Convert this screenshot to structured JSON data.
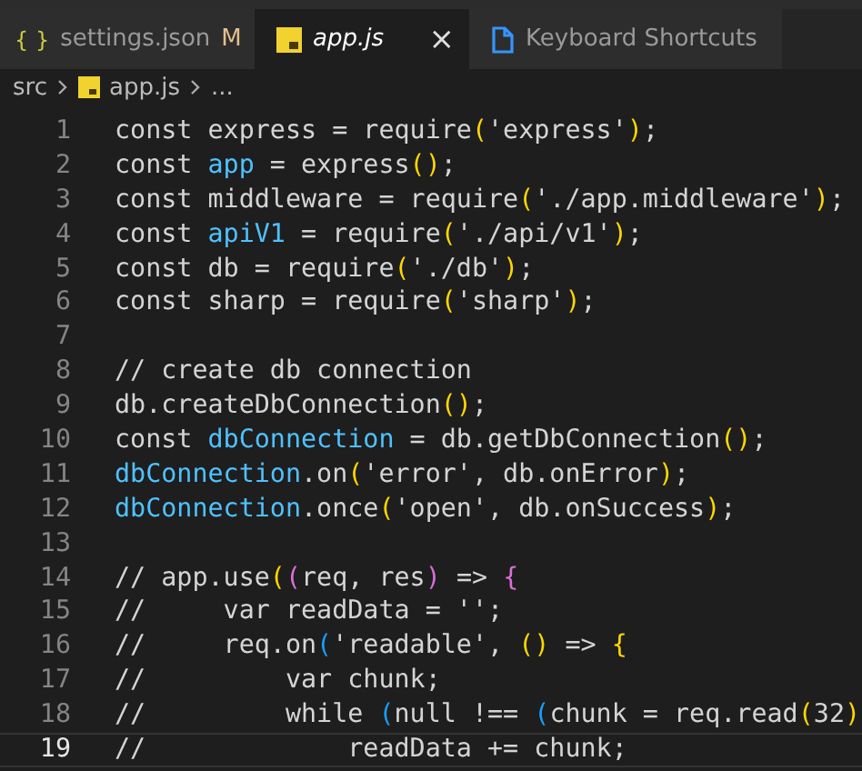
{
  "tabs": [
    {
      "kind": "json",
      "label": "settings.json",
      "badge": "M",
      "selected": false,
      "icon_text": "{ }"
    },
    {
      "kind": "js",
      "label": "app.js",
      "selected": true,
      "close": "×"
    },
    {
      "kind": "doc",
      "label": "Keyboard Shortcuts",
      "selected": false
    }
  ],
  "breadcrumb": {
    "folder": "src",
    "file": "app.js",
    "more": "..."
  },
  "lines": [
    {
      "number": "1",
      "current": false,
      "tokens": [
        {
          "kind": "text",
          "text": "const express = require"
        },
        {
          "kind": "bracket1",
          "text": "("
        },
        {
          "kind": "text",
          "text": "'express'"
        },
        {
          "kind": "bracket1",
          "text": ")"
        },
        {
          "kind": "text",
          "text": ";"
        }
      ]
    },
    {
      "number": "2",
      "current": false,
      "tokens": [
        {
          "kind": "text",
          "text": "const "
        },
        {
          "kind": "variable",
          "text": "app"
        },
        {
          "kind": "text",
          "text": " = express"
        },
        {
          "kind": "bracket1",
          "text": "()"
        },
        {
          "kind": "text",
          "text": ";"
        }
      ]
    },
    {
      "number": "3",
      "current": false,
      "tokens": [
        {
          "kind": "text",
          "text": "const middleware = require"
        },
        {
          "kind": "bracket1",
          "text": "("
        },
        {
          "kind": "text",
          "text": "'./app.middleware'"
        },
        {
          "kind": "bracket1",
          "text": ")"
        },
        {
          "kind": "text",
          "text": ";"
        }
      ]
    },
    {
      "number": "4",
      "current": false,
      "tokens": [
        {
          "kind": "text",
          "text": "const "
        },
        {
          "kind": "variable",
          "text": "apiV1"
        },
        {
          "kind": "text",
          "text": " = require"
        },
        {
          "kind": "bracket1",
          "text": "("
        },
        {
          "kind": "text",
          "text": "'./api/v1'"
        },
        {
          "kind": "bracket1",
          "text": ")"
        },
        {
          "kind": "text",
          "text": ";"
        }
      ]
    },
    {
      "number": "5",
      "current": false,
      "tokens": [
        {
          "kind": "text",
          "text": "const db = require"
        },
        {
          "kind": "bracket1",
          "text": "("
        },
        {
          "kind": "text",
          "text": "'./db'"
        },
        {
          "kind": "bracket1",
          "text": ")"
        },
        {
          "kind": "text",
          "text": ";"
        }
      ]
    },
    {
      "number": "6",
      "current": false,
      "tokens": [
        {
          "kind": "text",
          "text": "const sharp = require"
        },
        {
          "kind": "bracket1",
          "text": "("
        },
        {
          "kind": "text",
          "text": "'sharp'"
        },
        {
          "kind": "bracket1",
          "text": ")"
        },
        {
          "kind": "text",
          "text": ";"
        }
      ]
    },
    {
      "number": "7",
      "current": false
    },
    {
      "number": "8",
      "current": false,
      "tokens": [
        {
          "kind": "text",
          "text": "// create db connection"
        }
      ]
    },
    {
      "number": "9",
      "current": false,
      "tokens": [
        {
          "kind": "text",
          "text": "db.createDbConnection"
        },
        {
          "kind": "bracket1",
          "text": "()"
        },
        {
          "kind": "text",
          "text": ";"
        }
      ]
    },
    {
      "number": "10",
      "current": false,
      "tokens": [
        {
          "kind": "text",
          "text": "const "
        },
        {
          "kind": "variable",
          "text": "dbConnection"
        },
        {
          "kind": "text",
          "text": " = db.getDbConnection"
        },
        {
          "kind": "bracket1",
          "text": "()"
        },
        {
          "kind": "text",
          "text": ";"
        }
      ]
    },
    {
      "number": "11",
      "current": false,
      "tokens": [
        {
          "kind": "variable",
          "text": "dbConnection"
        },
        {
          "kind": "text",
          "text": ".on"
        },
        {
          "kind": "bracket1",
          "text": "("
        },
        {
          "kind": "text",
          "text": "'error', db.onError"
        },
        {
          "kind": "bracket1",
          "text": ")"
        },
        {
          "kind": "text",
          "text": ";"
        }
      ]
    },
    {
      "number": "12",
      "current": false,
      "tokens": [
        {
          "kind": "variable",
          "text": "dbConnection"
        },
        {
          "kind": "text",
          "text": ".once"
        },
        {
          "kind": "bracket1",
          "text": "("
        },
        {
          "kind": "text",
          "text": "'open', db.onSuccess"
        },
        {
          "kind": "bracket1",
          "text": ")"
        },
        {
          "kind": "text",
          "text": ";"
        }
      ]
    },
    {
      "number": "13",
      "current": false
    },
    {
      "number": "14",
      "current": false,
      "tokens": [
        {
          "kind": "text",
          "text": "// app.use"
        },
        {
          "kind": "bracket1",
          "text": "("
        },
        {
          "kind": "bracket2",
          "text": "("
        },
        {
          "kind": "text",
          "text": "req, res"
        },
        {
          "kind": "bracket2",
          "text": ")"
        },
        {
          "kind": "text",
          "text": " => "
        },
        {
          "kind": "bracket2",
          "text": "{"
        }
      ]
    },
    {
      "number": "15",
      "current": false,
      "tokens": [
        {
          "kind": "text",
          "text": "//     var readData = '';"
        }
      ]
    },
    {
      "number": "16",
      "current": false,
      "tokens": [
        {
          "kind": "text",
          "text": "//     req.on"
        },
        {
          "kind": "bracket3",
          "text": "("
        },
        {
          "kind": "text",
          "text": "'readable', "
        },
        {
          "kind": "bracket1",
          "text": "()"
        },
        {
          "kind": "text",
          "text": " => "
        },
        {
          "kind": "bracket1",
          "text": "{"
        }
      ]
    },
    {
      "number": "17",
      "current": false,
      "tokens": [
        {
          "kind": "text",
          "text": "//         var chunk;"
        }
      ]
    },
    {
      "number": "18",
      "current": false,
      "tokens": [
        {
          "kind": "text",
          "text": "//         while "
        },
        {
          "kind": "bracket3",
          "text": "("
        },
        {
          "kind": "text",
          "text": "null !== "
        },
        {
          "kind": "bracket3",
          "text": "("
        },
        {
          "kind": "text",
          "text": "chunk = req.read"
        },
        {
          "kind": "bracket1",
          "text": "("
        },
        {
          "kind": "text",
          "text": "32"
        },
        {
          "kind": "bracket1",
          "text": ")"
        }
      ]
    },
    {
      "number": "19",
      "current": true,
      "tokens": [
        {
          "kind": "text",
          "text": "//             readData += chunk;"
        }
      ]
    }
  ]
}
